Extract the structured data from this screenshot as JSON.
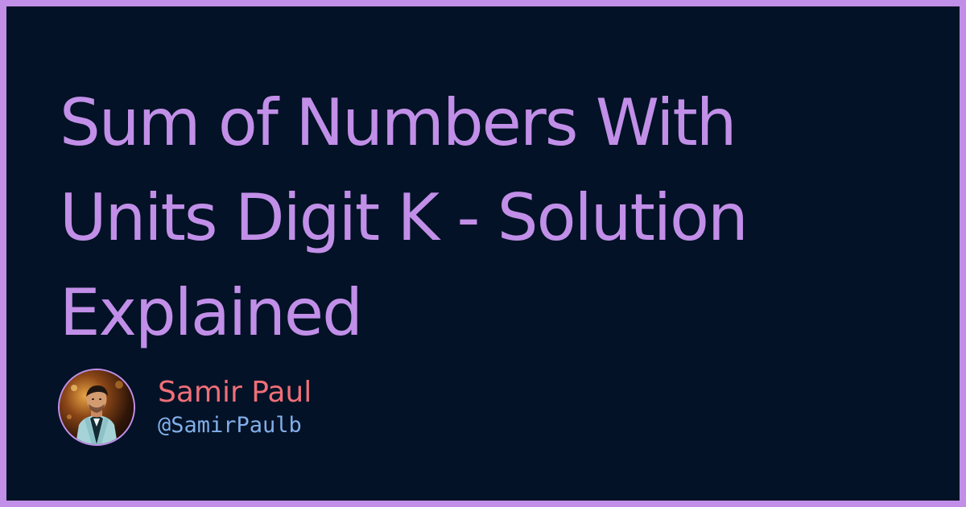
{
  "title_lines": [
    "Sum of Numbers With",
    "Units Digit K - Solution",
    "Explained"
  ],
  "author": {
    "name": "Samir Paul",
    "handle": "@SamirPaulb",
    "avatar_icon": "person-photo-icon"
  },
  "colors": {
    "border": "#c18fe8",
    "background": "#031226",
    "title": "#c18fe8",
    "author_name": "#ef6f78",
    "author_handle": "#82aeea"
  }
}
